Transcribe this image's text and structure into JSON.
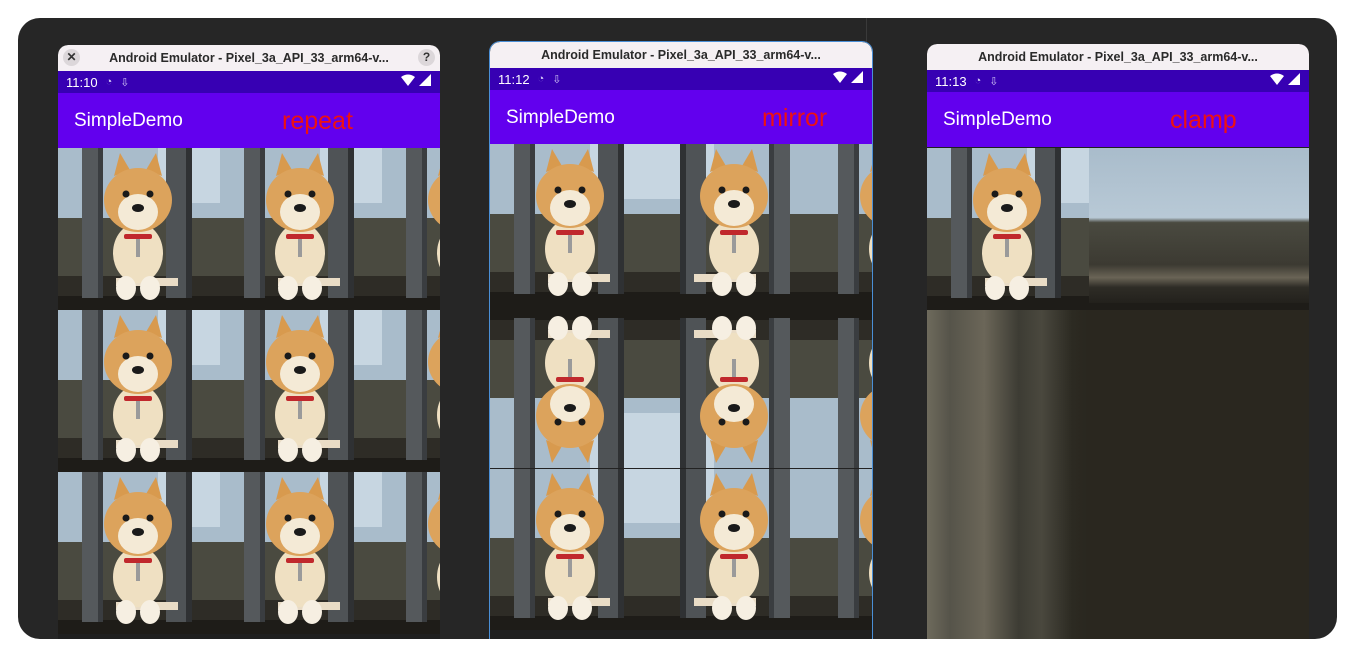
{
  "windows": [
    {
      "title": "Android Emulator - Pixel_3a_API_33_arm64-v...",
      "time": "11:10",
      "app_title": "SimpleDemo",
      "mode_label": "repeat",
      "tile_mode": "repeat"
    },
    {
      "title": "Android Emulator - Pixel_3a_API_33_arm64-v...",
      "time": "11:12",
      "app_title": "SimpleDemo",
      "mode_label": "mirror",
      "tile_mode": "mirror"
    },
    {
      "title": "Android Emulator - Pixel_3a_API_33_arm64-v...",
      "time": "11:13",
      "app_title": "SimpleDemo",
      "mode_label": "clamp",
      "tile_mode": "clamp"
    }
  ],
  "icons": {
    "close": "close-icon",
    "help": "help-icon",
    "wifi": "wifi-icon",
    "signal": "signal-icon",
    "tile_image": "shiba-dog-image"
  },
  "colors": {
    "status_bar": "#3700b3",
    "app_bar": "#6200ee",
    "mode_label": "#ee1111",
    "desk": "#262626"
  }
}
